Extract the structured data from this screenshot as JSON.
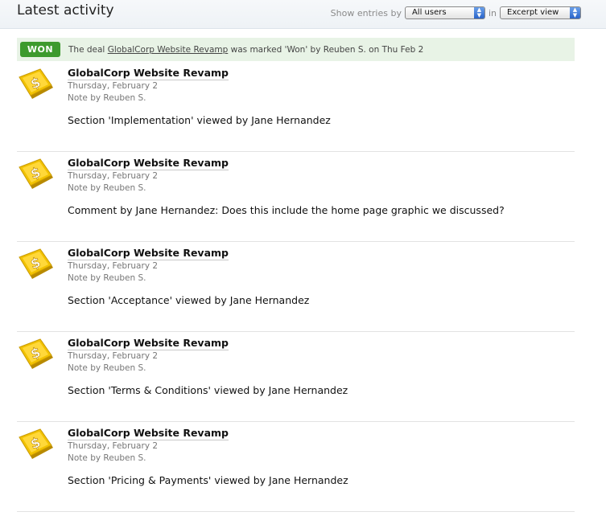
{
  "header": {
    "title": "Latest activity",
    "show_entries_label": "Show entries by",
    "user_filter": "All users",
    "in_label": "in",
    "view_filter": "Excerpt view"
  },
  "banner": {
    "badge": "WON",
    "prefix": "The deal",
    "deal_link": "GlobalCorp Website Revamp",
    "suffix": "was marked 'Won' by Reuben S. on Thu Feb 2"
  },
  "entries": [
    {
      "title": "GlobalCorp Website Revamp",
      "date": "Thursday, February 2",
      "note": "Note by Reuben S.",
      "body": "Section 'Implementation' viewed by Jane Hernandez",
      "icon": "deal-dollar-icon"
    },
    {
      "title": "GlobalCorp Website Revamp",
      "date": "Thursday, February 2",
      "note": "Note by Reuben S.",
      "body": "Comment by Jane Hernandez: Does this include the home page graphic we discussed?",
      "icon": "deal-dollar-icon"
    },
    {
      "title": "GlobalCorp Website Revamp",
      "date": "Thursday, February 2",
      "note": "Note by Reuben S.",
      "body": "Section 'Acceptance' viewed by Jane Hernandez",
      "icon": "deal-dollar-icon"
    },
    {
      "title": "GlobalCorp Website Revamp",
      "date": "Thursday, February 2",
      "note": "Note by Reuben S.",
      "body": "Section 'Terms & Conditions' viewed by Jane Hernandez",
      "icon": "deal-dollar-icon"
    },
    {
      "title": "GlobalCorp Website Revamp",
      "date": "Thursday, February 2",
      "note": "Note by Reuben S.",
      "body": "Section 'Pricing & Payments' viewed by Jane Hernandez",
      "icon": "deal-dollar-icon"
    }
  ],
  "colors": {
    "won_badge": "#3d9a2e",
    "banner_bg": "#e8f3e6",
    "icon_gold": "#f2c200"
  }
}
